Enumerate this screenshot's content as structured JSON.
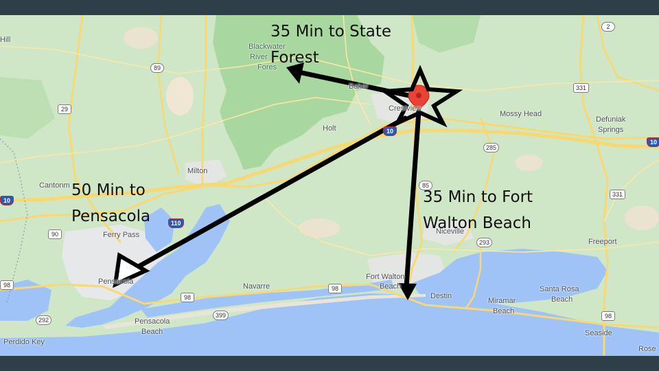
{
  "map": {
    "colors": {
      "land": "#cfe7c6",
      "forest": "#a9d7a0",
      "water": "#9fc3f7",
      "urban": "#e7e8ea",
      "sand": "#efe7d4",
      "road": "#f7d873",
      "frame": "#2f3f49",
      "marker": "#ea4335",
      "arrow": "#000000"
    },
    "places": [
      {
        "id": "hill",
        "name": "Hill"
      },
      {
        "id": "blackwater-1",
        "name": "Blackwater"
      },
      {
        "id": "blackwater-2",
        "name": "River"
      },
      {
        "id": "blackwater-3",
        "name": "Fores"
      },
      {
        "id": "baker",
        "name": "Baker"
      },
      {
        "id": "crestview",
        "name": "Crestview"
      },
      {
        "id": "holt",
        "name": "Holt"
      },
      {
        "id": "mossy-head",
        "name": "Mossy Head"
      },
      {
        "id": "defuniak-1",
        "name": "Defuniak"
      },
      {
        "id": "defuniak-2",
        "name": "Springs"
      },
      {
        "id": "milton",
        "name": "Milton"
      },
      {
        "id": "cantonment",
        "name": "Cantonm"
      },
      {
        "id": "ferry-pass",
        "name": "Ferry Pass"
      },
      {
        "id": "pensacola",
        "name": "Pensacola"
      },
      {
        "id": "niceville",
        "name": "Niceville"
      },
      {
        "id": "freeport",
        "name": "Freeport"
      },
      {
        "id": "navarre",
        "name": "Navarre"
      },
      {
        "id": "fort-walton-1",
        "name": "Fort Walton"
      },
      {
        "id": "fort-walton-2",
        "name": "Beach"
      },
      {
        "id": "destin",
        "name": "Destin"
      },
      {
        "id": "miramar-1",
        "name": "Miramar"
      },
      {
        "id": "miramar-2",
        "name": "Beach"
      },
      {
        "id": "santa-rosa-1",
        "name": "Santa Rosa"
      },
      {
        "id": "santa-rosa-2",
        "name": "Beach"
      },
      {
        "id": "pensacola-beach-1",
        "name": "Pensacola"
      },
      {
        "id": "pensacola-beach-2",
        "name": "Beach"
      },
      {
        "id": "perdido-key",
        "name": "Perdido Key"
      },
      {
        "id": "seaside",
        "name": "Seaside"
      },
      {
        "id": "rose",
        "name": "Rose"
      }
    ],
    "shields": [
      {
        "id": "us-2",
        "label": "2"
      },
      {
        "id": "sr-89",
        "label": "89"
      },
      {
        "id": "us-29",
        "label": "29"
      },
      {
        "id": "us-331-north",
        "label": "331"
      },
      {
        "id": "i-10-crestview",
        "label": "10"
      },
      {
        "id": "i-10-east",
        "label": "10"
      },
      {
        "id": "sr-285",
        "label": "285"
      },
      {
        "id": "us-331-south",
        "label": "331"
      },
      {
        "id": "sr-85",
        "label": "85"
      },
      {
        "id": "i-10-west",
        "label": "10"
      },
      {
        "id": "i-110",
        "label": "110"
      },
      {
        "id": "us-90",
        "label": "90"
      },
      {
        "id": "sr-293",
        "label": "293"
      },
      {
        "id": "us-98-west",
        "label": "98"
      },
      {
        "id": "us-98-navarre",
        "label": "98"
      },
      {
        "id": "us-98-gulf",
        "label": "98"
      },
      {
        "id": "us-98-east",
        "label": "98"
      },
      {
        "id": "sr-399",
        "label": "399"
      },
      {
        "id": "sr-292",
        "label": "292"
      }
    ],
    "annotations": [
      {
        "id": "state-forest",
        "lines": [
          "35 Min to State",
          "Forest"
        ]
      },
      {
        "id": "pensacola",
        "lines": [
          "50 Min to",
          "Pensacola"
        ]
      },
      {
        "id": "fort-walton",
        "lines": [
          "35 Min to Fort",
          "Walton Beach"
        ]
      }
    ],
    "origin_marker": "location-pin-with-star"
  }
}
